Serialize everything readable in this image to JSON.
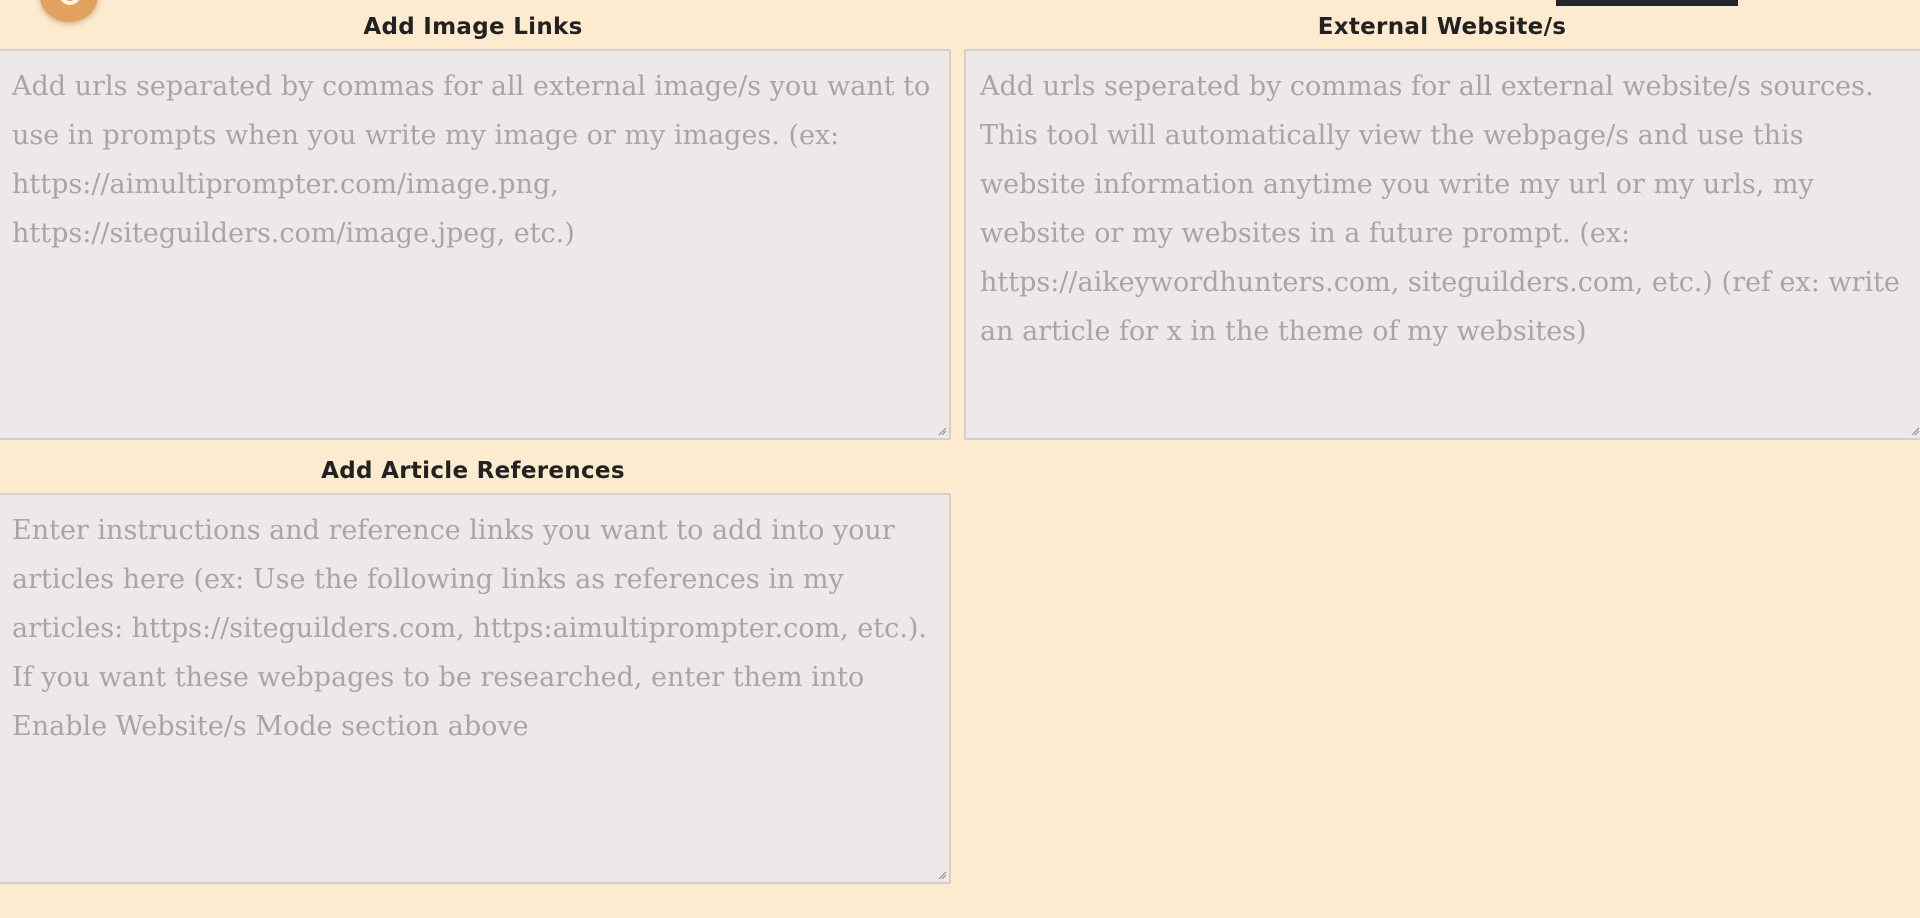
{
  "image_links": {
    "label": "Add Image Links",
    "value": "",
    "placeholder": "Add urls separated by commas for all external image/s you want to use in prompts when you write my image or my images. (ex: https://aimultiprompter.com/image.png, https://siteguilders.com/image.jpeg, etc.)"
  },
  "external_websites": {
    "label": "External Website/s",
    "value": "",
    "placeholder": "Add urls seperated by commas for all external website/s sources. This tool will automatically view the webpage/s and use this website information anytime you write my url or my urls, my website or my websites in a future prompt. (ex: https://aikeywordhunters.com, siteguilders.com, etc.) (ref ex: write an article for x in the theme of my websites)"
  },
  "article_references": {
    "label": "Add Article References",
    "value": "",
    "placeholder": "Enter instructions and reference links you want to add into your articles here (ex: Use the following links as references in my articles: https://siteguilders.com, https:aimultiprompter.com, etc.). If you want these webpages to be researched, enter them into Enable Website/s Mode section above"
  },
  "colors": {
    "page_background": "#fdebd0",
    "field_background": "#ede9e8",
    "accent_orange": "#e3a15f",
    "dark_tab": "#22252b"
  },
  "icons": {
    "top_left_button": "orange-circle-button-icon",
    "resize_grip": "resize-grip-icon"
  }
}
